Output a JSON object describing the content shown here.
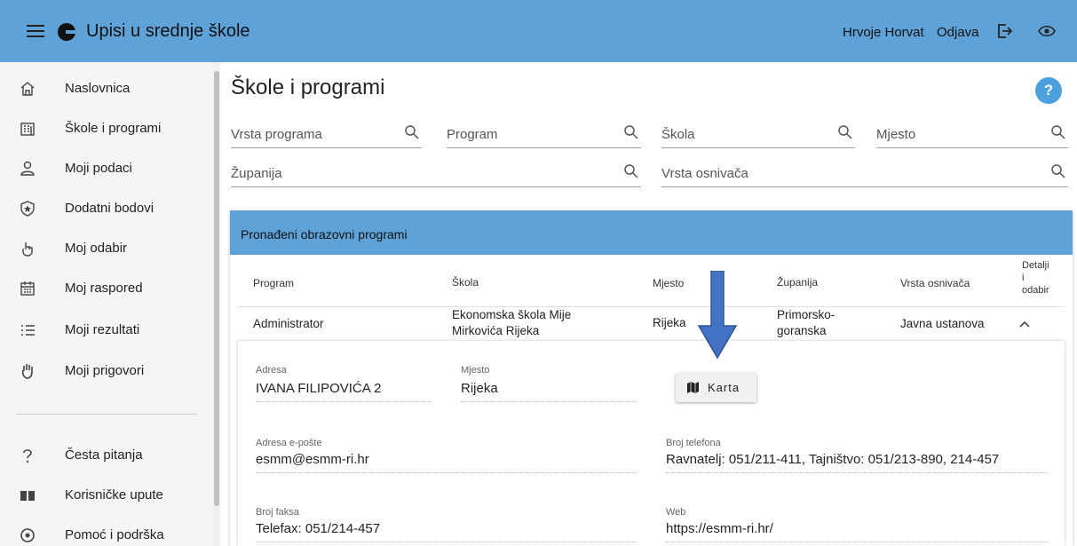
{
  "header": {
    "app_title": "Upisi u srednje škole",
    "user_name": "Hrvoje Horvat",
    "logout_label": "Odjava",
    "icons": [
      "menu-icon",
      "app-logo",
      "logout-icon",
      "eye-icon"
    ]
  },
  "sidebar": {
    "items": [
      {
        "label": "Naslovnica",
        "icon": "home-icon"
      },
      {
        "label": "Škole i programi",
        "icon": "building-icon"
      },
      {
        "label": "Moji podaci",
        "icon": "user-icon"
      },
      {
        "label": "Dodatni bodovi",
        "icon": "star-shield-icon"
      },
      {
        "label": "Moj odabir",
        "icon": "pointer-hand-icon"
      },
      {
        "label": "Moj raspored",
        "icon": "calendar-icon"
      },
      {
        "label": "Moji rezultati",
        "icon": "list-icon"
      },
      {
        "label": "Moji prigovori",
        "icon": "raised-hand-icon"
      }
    ],
    "secondary_items": [
      {
        "label": "Česta pitanja",
        "icon": "question-icon"
      },
      {
        "label": "Korisničke upute",
        "icon": "book-icon"
      },
      {
        "label": "Pomoć i podrška",
        "icon": "support-icon"
      }
    ]
  },
  "main": {
    "page_title": "Škole i programi",
    "help_label": "?",
    "filters": {
      "vrsta_programa": "Vrsta programa",
      "program": "Program",
      "skola": "Škola",
      "mjesto": "Mjesto",
      "zupanija": "Županija",
      "vrsta_osnivaca": "Vrsta osnivača"
    },
    "results_panel": {
      "title": "Pronađeni obrazovni programi",
      "columns": {
        "program": "Program",
        "skola": "Škola",
        "mjesto": "Mjesto",
        "zupanija": "Županija",
        "vrsta_osnivaca": "Vrsta osnivača",
        "detalji_1": "Detalji",
        "detalji_2": "i",
        "detalji_3": "odabir"
      },
      "row": {
        "program": "Administrator",
        "skola_1": "Ekonomska škola Mije",
        "skola_2": "Mirkovića Rijeka",
        "mjesto": "Rijeka",
        "zupanija_1": "Primorsko-",
        "zupanija_2": "goranska",
        "vrsta_osnivaca": "Javna ustanova",
        "expand_icon": "chevron-up-icon"
      },
      "details": {
        "adresa_label": "Adresa",
        "adresa": "IVANA FILIPOVIĆA 2",
        "mjesto_label": "Mjesto",
        "mjesto": "Rijeka",
        "karta_label": "Karta",
        "email_label": "Adresa e-pošte",
        "email": "esmm@esmm-ri.hr",
        "telefon_label": "Broj telefona",
        "telefon": "Ravnatelj: 051/211-411, Tajništvo: 051/213-890, 214-457",
        "faks_label": "Broj faksa",
        "faks": "Telefax: 051/214-457",
        "web_label": "Web",
        "web": "https://esmm-ri.hr/"
      }
    }
  },
  "colors": {
    "header_bg": "#5fa2d8",
    "help_btn": "#4aa1de",
    "annotation_arrow": "#4472c4"
  }
}
